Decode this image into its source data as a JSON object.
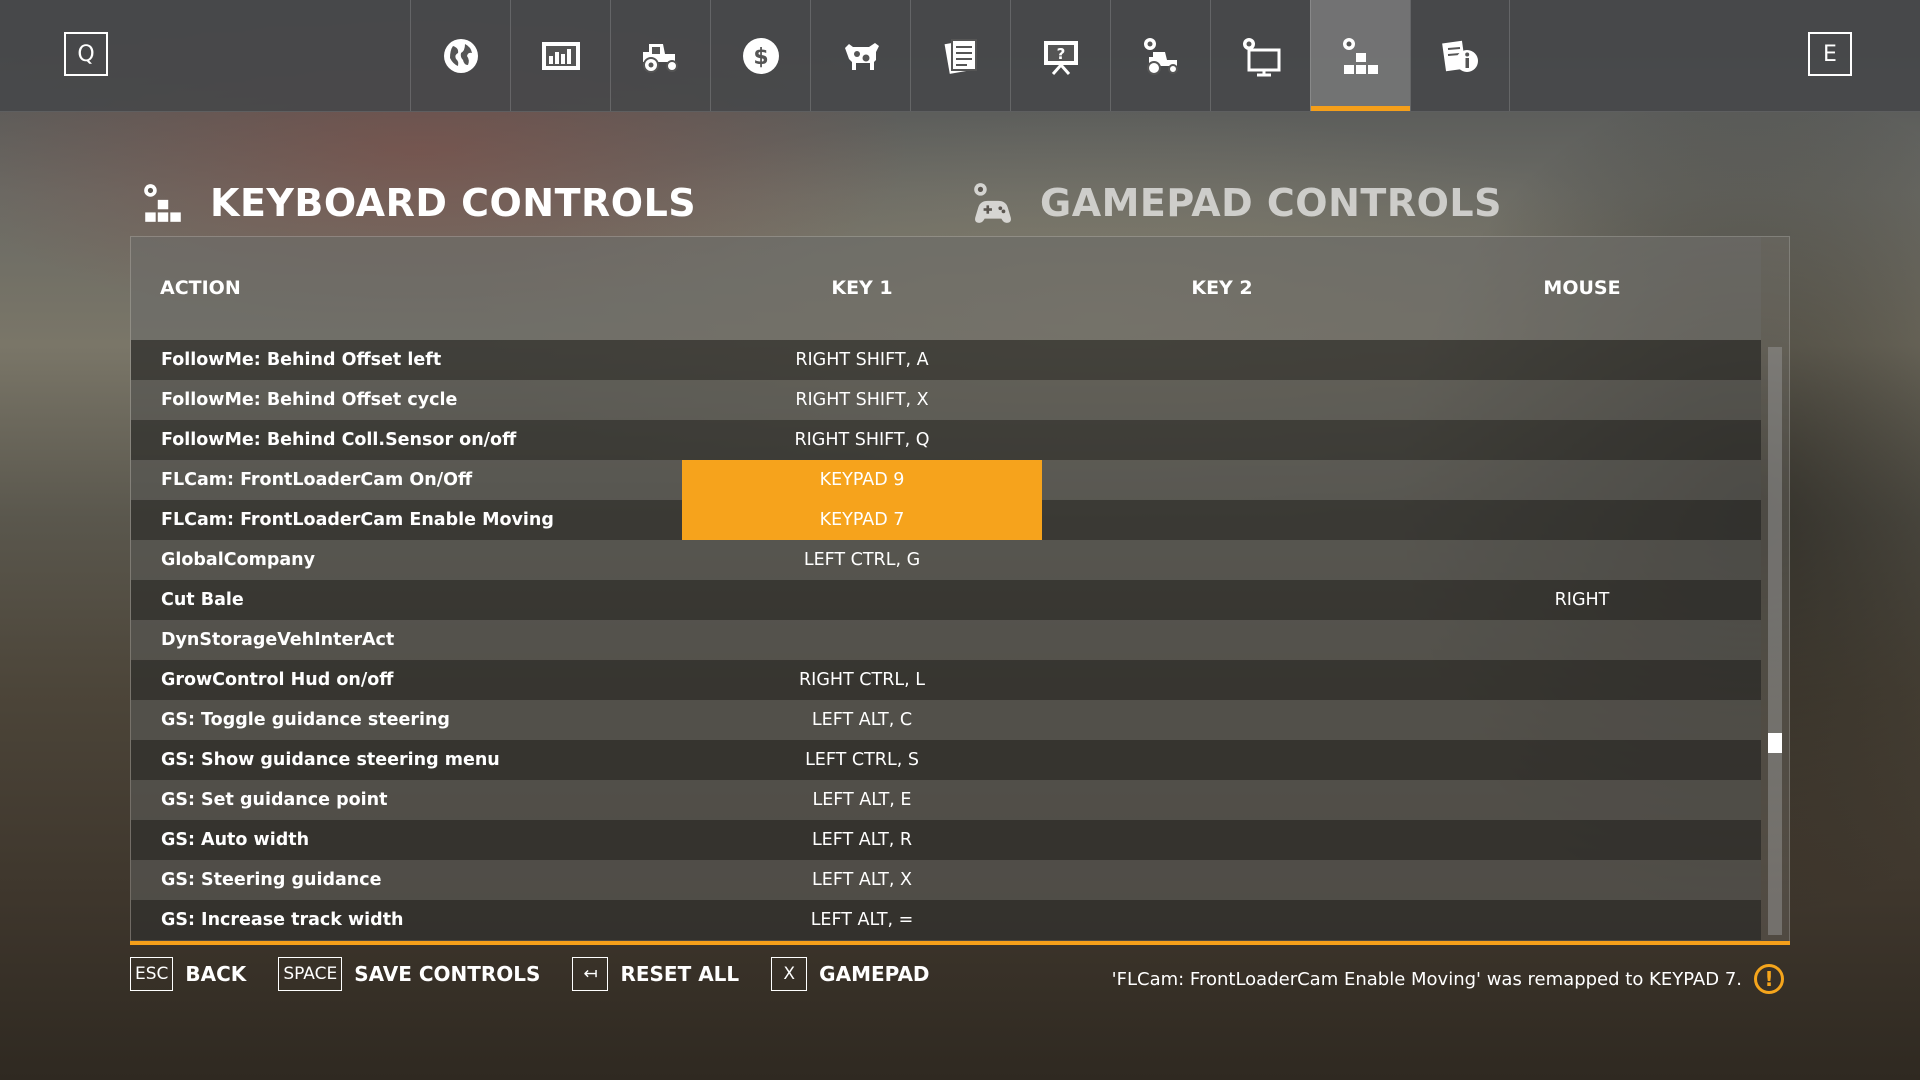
{
  "topbar": {
    "left_key": "Q",
    "right_key": "E",
    "tabs": [
      {
        "icon": "globe-icon"
      },
      {
        "icon": "statistics-icon"
      },
      {
        "icon": "tractor-icon"
      },
      {
        "icon": "finances-icon"
      },
      {
        "icon": "animals-icon"
      },
      {
        "icon": "contracts-icon"
      },
      {
        "icon": "help-presentation-icon"
      },
      {
        "icon": "vehicle-settings-icon"
      },
      {
        "icon": "display-settings-icon"
      },
      {
        "icon": "controls-settings-icon",
        "active": true
      },
      {
        "icon": "info-icon"
      }
    ]
  },
  "headings": {
    "keyboard": "KEYBOARD CONTROLS",
    "gamepad": "GAMEPAD CONTROLS"
  },
  "table": {
    "columns": {
      "action": "ACTION",
      "key1": "KEY 1",
      "key2": "KEY 2",
      "mouse": "MOUSE"
    },
    "rows": [
      {
        "action": "FollowMe: Behind Offset left",
        "key1": "RIGHT SHIFT, A",
        "key2": "",
        "mouse": ""
      },
      {
        "action": "FollowMe: Behind Offset cycle",
        "key1": "RIGHT SHIFT, X",
        "key2": "",
        "mouse": ""
      },
      {
        "action": "FollowMe: Behind Coll.Sensor on/off",
        "key1": "RIGHT SHIFT, Q",
        "key2": "",
        "mouse": ""
      },
      {
        "action": "FLCam: FrontLoaderCam On/Off",
        "key1": "KEYPAD 9",
        "key2": "",
        "mouse": "",
        "selected": true
      },
      {
        "action": "FLCam: FrontLoaderCam Enable Moving",
        "key1": "KEYPAD 7",
        "key2": "",
        "mouse": "",
        "selected": true
      },
      {
        "action": "GlobalCompany",
        "key1": "LEFT CTRL, G",
        "key2": "",
        "mouse": ""
      },
      {
        "action": "Cut Bale",
        "key1": "",
        "key2": "",
        "mouse": "RIGHT"
      },
      {
        "action": "DynStorageVehInterAct",
        "key1": "",
        "key2": "",
        "mouse": ""
      },
      {
        "action": "GrowControl Hud on/off",
        "key1": "RIGHT CTRL, L",
        "key2": "",
        "mouse": ""
      },
      {
        "action": "GS: Toggle guidance steering",
        "key1": "LEFT ALT, C",
        "key2": "",
        "mouse": ""
      },
      {
        "action": "GS: Show guidance steering menu",
        "key1": "LEFT CTRL, S",
        "key2": "",
        "mouse": ""
      },
      {
        "action": "GS: Set guidance point",
        "key1": "LEFT ALT, E",
        "key2": "",
        "mouse": ""
      },
      {
        "action": "GS: Auto width",
        "key1": "LEFT ALT, R",
        "key2": "",
        "mouse": ""
      },
      {
        "action": "GS: Steering guidance",
        "key1": "LEFT ALT, X",
        "key2": "",
        "mouse": ""
      },
      {
        "action": "GS: Increase track width",
        "key1": "LEFT ALT, =",
        "key2": "",
        "mouse": ""
      }
    ],
    "scroll_position": 0.68
  },
  "footer": {
    "buttons": [
      {
        "key": "ESC",
        "label": "BACK"
      },
      {
        "key": "SPACE",
        "label": "SAVE CONTROLS"
      },
      {
        "key": "↤",
        "label": "RESET ALL"
      },
      {
        "key": "X",
        "label": "GAMEPAD"
      }
    ],
    "notice": "'FLCam: FrontLoaderCam Enable Moving' was remapped to KEYPAD 7.",
    "notice_icon": "!"
  },
  "colors": {
    "accent": "#f59f1a",
    "selected_cell": "#f6a31c"
  }
}
